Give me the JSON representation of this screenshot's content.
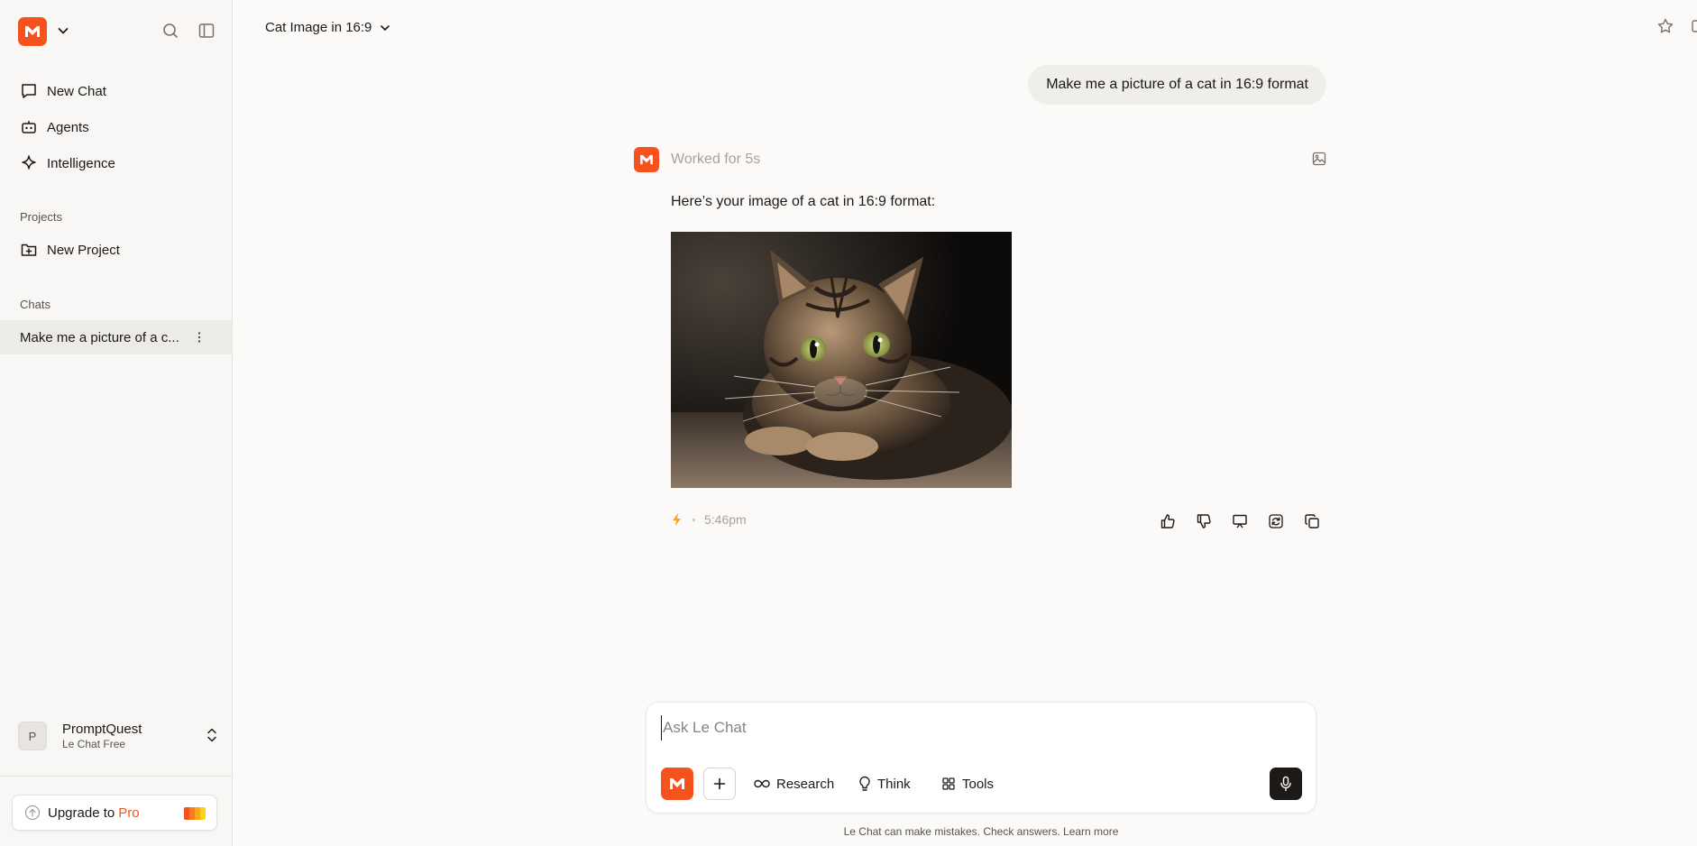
{
  "sidebar": {
    "nav": [
      {
        "label": "New Chat",
        "icon": "chat-bubble-icon"
      },
      {
        "label": "Agents",
        "icon": "robot-icon"
      },
      {
        "label": "Intelligence",
        "icon": "sparkle-icon"
      }
    ],
    "projects_label": "Projects",
    "new_project_label": "New Project",
    "chats_label": "Chats",
    "chats": [
      {
        "title": "Make me a picture of a c..."
      }
    ],
    "user": {
      "initial": "P",
      "name": "PromptQuest",
      "plan": "Le Chat Free"
    },
    "upgrade": {
      "label": "Upgrade to",
      "pro": "Pro"
    }
  },
  "header": {
    "chat_title": "Cat Image in 16:9"
  },
  "conversation": {
    "user_message": "Make me a picture of a cat in 16:9 format",
    "assistant": {
      "status": "Worked for 5s",
      "text": "Here’s your image of a cat in 16:9 format:",
      "time": "5:46pm"
    }
  },
  "composer": {
    "placeholder": "Ask Le Chat",
    "tools": [
      {
        "label": "Research",
        "icon": "infinity-icon"
      },
      {
        "label": "Think",
        "icon": "lightbulb-icon"
      },
      {
        "label": "Tools",
        "icon": "grid-icon"
      }
    ]
  },
  "footer": {
    "disclaimer": "Le Chat can make mistakes. Check answers. Learn more"
  },
  "colors": {
    "brand": "#f5521e",
    "background": "#fbfaf8",
    "sidebar": "#f8f7f5",
    "text": "#1c1917",
    "muted": "#a8a29e"
  }
}
